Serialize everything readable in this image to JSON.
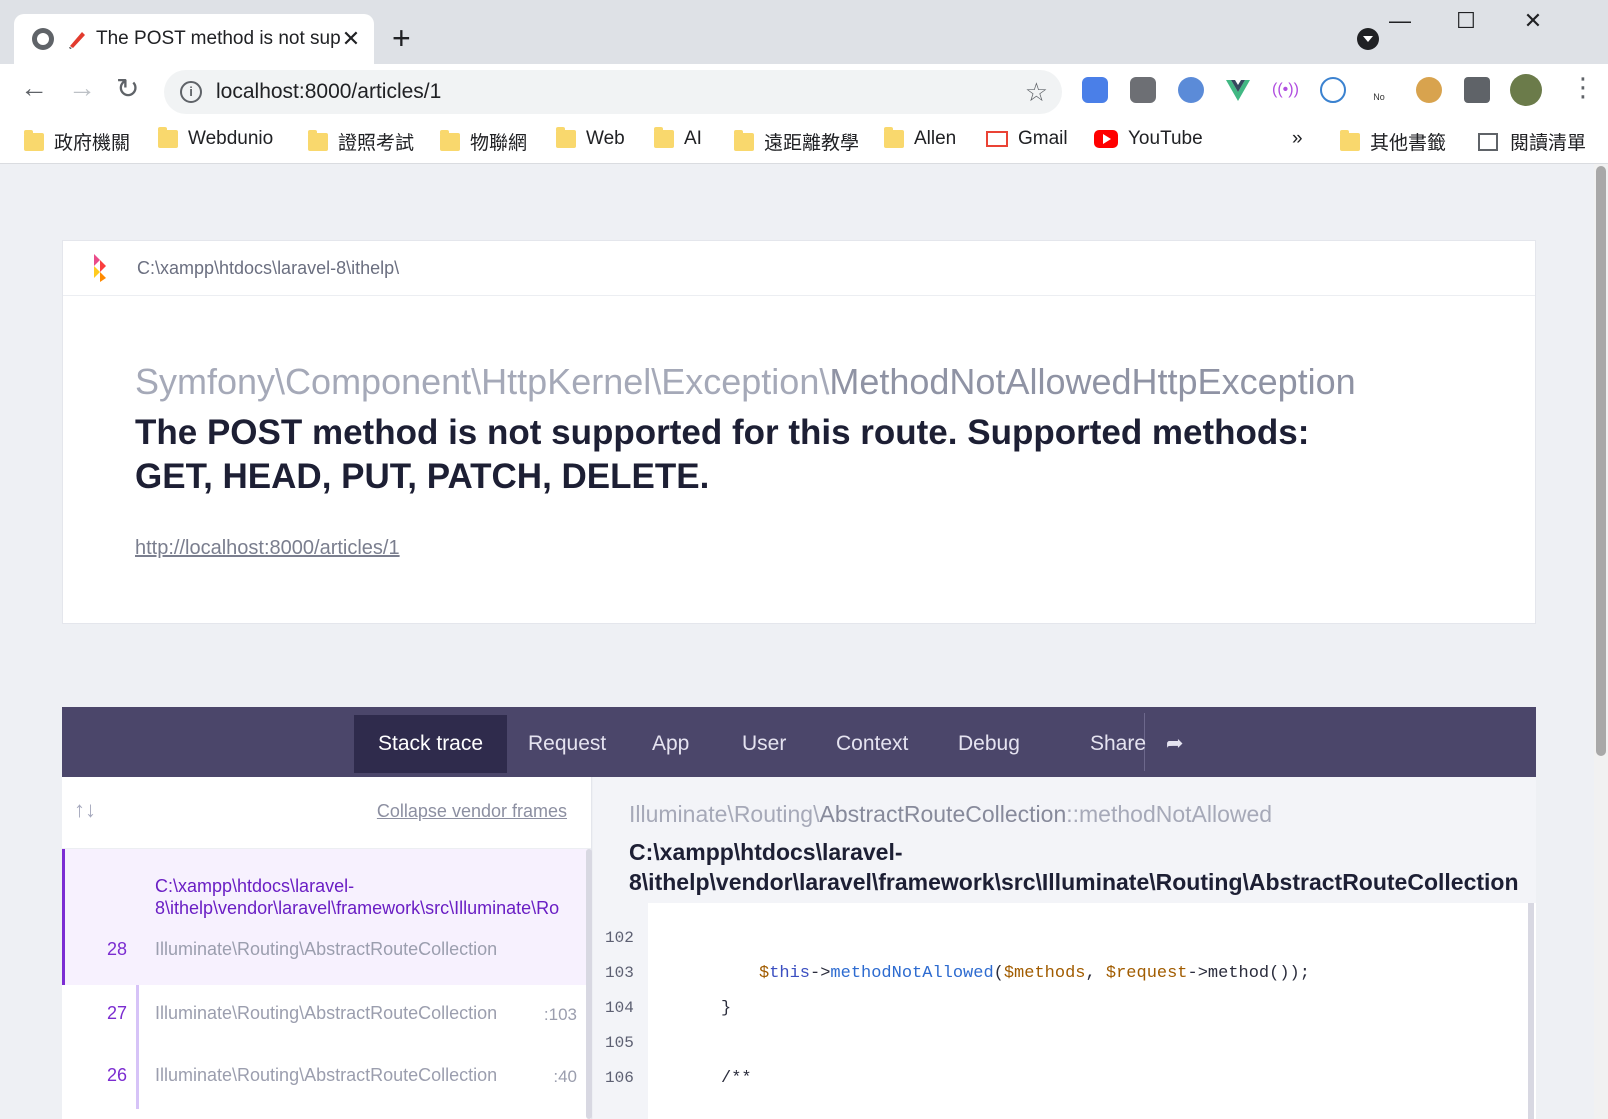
{
  "browser": {
    "tab_title": "The POST method is not sup",
    "new_tab": "+",
    "close_tab": "✕",
    "url": "localhost:8000/articles/1",
    "window_controls": {
      "minimize": "—",
      "maximize": "☐",
      "close": "✕"
    },
    "bookmarks": [
      {
        "label": "政府機關",
        "icon": "folder-icon"
      },
      {
        "label": "Webdunio",
        "icon": "folder-icon"
      },
      {
        "label": "證照考試",
        "icon": "folder-icon"
      },
      {
        "label": "物聯網",
        "icon": "folder-icon"
      },
      {
        "label": "Web",
        "icon": "folder-icon"
      },
      {
        "label": "AI",
        "icon": "folder-icon"
      },
      {
        "label": "遠距離教學",
        "icon": "folder-icon"
      },
      {
        "label": "Allen",
        "icon": "folder-icon"
      },
      {
        "label": "Gmail",
        "icon": "gmail-icon"
      },
      {
        "label": "YouTube",
        "icon": "youtube-icon"
      }
    ],
    "bookmarks_overflow": "»",
    "other_bookmarks": "其他書籤",
    "reading_list": "閱讀清單",
    "extension_no_ads": "No ads"
  },
  "ignition": {
    "app_path": "C:\\xampp\\htdocs\\laravel-8\\ithelp\\",
    "exception_namespace": "Symfony\\Component\\HttpKernel\\Exception\\",
    "exception_class": "MethodNotAllowedHttpException",
    "message": "The POST method is not supported for this route. Supported methods: GET, HEAD, PUT, PATCH, DELETE.",
    "request_url": "http://localhost:8000/articles/1",
    "tabs": [
      "Stack trace",
      "Request",
      "App",
      "User",
      "Context",
      "Debug",
      "Share"
    ],
    "active_tab": "Stack trace",
    "collapse_vendor": "Collapse vendor frames",
    "frames": [
      {
        "num": "28",
        "file": "C:\\xampp\\htdocs\\laravel-8\\ithelp\\vendor\\laravel\\framework\\src\\Illuminate\\Ro",
        "file_line1": "C:\\xampp\\htdocs\\laravel-",
        "file_line2": "8\\ithelp\\vendor\\laravel\\framework\\src\\Illuminate\\Ro",
        "cls": "Illuminate\\Routing\\AbstractRouteCollection",
        "line": ""
      },
      {
        "num": "27",
        "cls": "Illuminate\\Routing\\AbstractRouteCollection",
        "line": ":103"
      },
      {
        "num": "26",
        "cls": "Illuminate\\Routing\\AbstractRouteCollection",
        "line": ":40"
      }
    ],
    "detail": {
      "class_ns": "Illuminate\\Routing\\",
      "class_name": "AbstractRouteCollection",
      "method": "::methodNotAllowed",
      "path_line1": "C:\\xampp\\htdocs\\laravel-",
      "path_line2": "8\\ithelp\\vendor\\laravel\\framework\\src\\Illuminate\\Routing\\AbstractRouteCollection"
    },
    "code_lines": [
      {
        "num": "102",
        "text": ""
      },
      {
        "num": "103",
        "text": "$this->methodNotAllowed($methods, $request->method());"
      },
      {
        "num": "104",
        "text": "}"
      },
      {
        "num": "105",
        "text": ""
      },
      {
        "num": "106",
        "text": "/**"
      }
    ]
  }
}
